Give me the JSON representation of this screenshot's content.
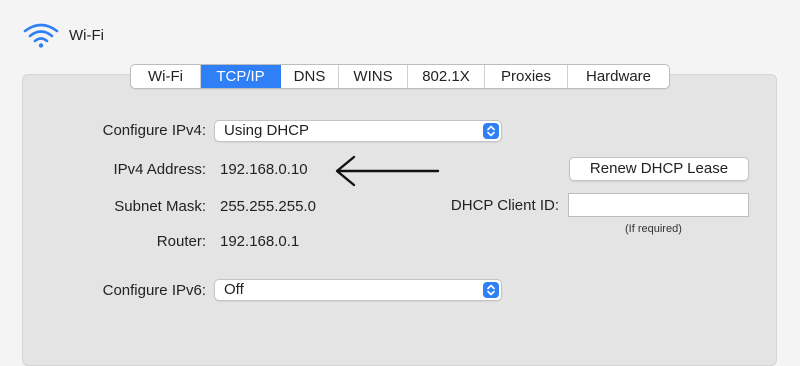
{
  "header": {
    "title": "Wi-Fi",
    "icon": "wifi-icon"
  },
  "tabs": [
    {
      "label": "Wi-Fi",
      "active": false
    },
    {
      "label": "TCP/IP",
      "active": true
    },
    {
      "label": "DNS",
      "active": false
    },
    {
      "label": "WINS",
      "active": false
    },
    {
      "label": "802.1X",
      "active": false
    },
    {
      "label": "Proxies",
      "active": false
    },
    {
      "label": "Hardware",
      "active": false
    }
  ],
  "ipv4": {
    "configure_label": "Configure IPv4:",
    "configure_value": "Using DHCP",
    "address_label": "IPv4 Address:",
    "address_value": "192.168.0.10",
    "subnet_label": "Subnet Mask:",
    "subnet_value": "255.255.255.0",
    "router_label": "Router:",
    "router_value": "192.168.0.1"
  },
  "dhcp": {
    "renew_label": "Renew DHCP Lease",
    "client_id_label": "DHCP Client ID:",
    "client_id_value": "",
    "client_id_hint": "(If required)"
  },
  "ipv6": {
    "configure_label": "Configure IPv6:",
    "configure_value": "Off"
  },
  "colors": {
    "accent": "#2f7ff6",
    "panel": "#e4e4e4",
    "background": "#f4f4f4"
  }
}
